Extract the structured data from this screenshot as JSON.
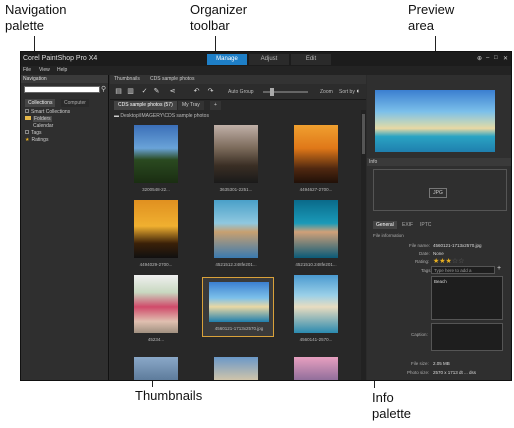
{
  "callouts": {
    "navigation": "Navigation\npalette",
    "organizer": "Organizer\ntoolbar",
    "preview": "Preview\narea",
    "thumbnails": "Thumbnails",
    "info": "Info\npalette"
  },
  "window": {
    "title": "Corel PaintShop Pro X4",
    "workspace_tabs": [
      "Manage",
      "Adjust",
      "Edit"
    ],
    "active_tab": "Manage",
    "menu": [
      "File",
      "View",
      "Help"
    ]
  },
  "left_panel": {
    "header": "Navigation",
    "tabs": [
      "Collections",
      "Computer"
    ],
    "tree": [
      "Smart Collections",
      "Folders",
      "Calendar",
      "Tags",
      "Ratings"
    ]
  },
  "center": {
    "tabs": [
      "Thumbnails",
      "CDS sample photos"
    ],
    "toolbar": {
      "auto_group": "Auto Group",
      "zoom": "Zoom",
      "sort_by": "Sort by"
    },
    "tray_tabs": [
      "CDS sample photos (57)",
      "My Tray",
      "+"
    ],
    "path": "Desktop\\IMAGERY\\CDS sample photos",
    "thumbs": [
      {
        "caption": "3200548-22..."
      },
      {
        "caption": "3635301-2251..."
      },
      {
        "caption": "4494627-2700..."
      },
      {
        "caption": "4494029-2700..."
      },
      {
        "caption": "4521512.248fe201..."
      },
      {
        "caption": "4521510.248fe201..."
      },
      {
        "caption": "45234..."
      },
      {
        "caption": "4560121-1713x2570.jpg"
      },
      {
        "caption": "4560141-2570..."
      }
    ]
  },
  "info": {
    "header": "Info",
    "jpg_label": "JPG",
    "tabs": [
      "General",
      "EXIF",
      "IPTC"
    ],
    "section": "File information",
    "file_name_label": "File name:",
    "file_name": "4560121-1713x2570.jpg",
    "date_label": "Date:",
    "date": "None",
    "rating_label": "Rating:",
    "tags_label": "Tags:",
    "tags_placeholder": "Type here to add a",
    "tag_value": "Beach",
    "caption_label": "Caption:",
    "file_size_label": "File size:",
    "file_size": "2.05 MB",
    "photo_size_label": "Photo size:",
    "photo_size": "2570 x 1713 dt ... dss",
    "rating_value": 3,
    "rating_max": 5
  }
}
